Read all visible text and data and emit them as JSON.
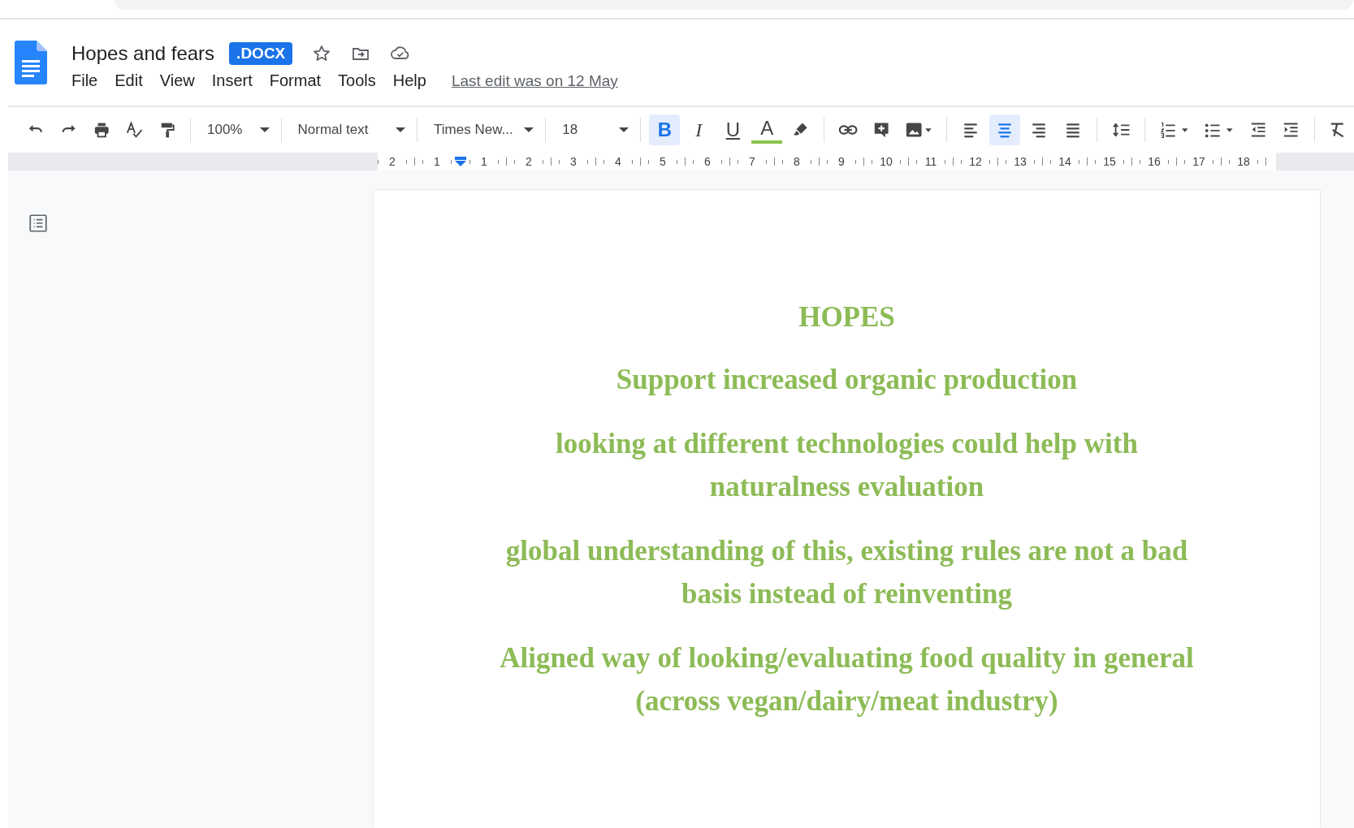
{
  "document": {
    "title": "Hopes and fears",
    "format_badge": ".DOCX",
    "last_edit": "Last edit was on 12 May"
  },
  "menu": [
    {
      "label": "File"
    },
    {
      "label": "Edit"
    },
    {
      "label": "View"
    },
    {
      "label": "Insert"
    },
    {
      "label": "Format"
    },
    {
      "label": "Tools"
    },
    {
      "label": "Help"
    }
  ],
  "toolbar": {
    "zoom": "100%",
    "style": "Normal text",
    "font": "Times New...",
    "size": "18",
    "format_buttons": [
      {
        "kind": "bold",
        "label": "B",
        "selected": true
      },
      {
        "kind": "italic",
        "label": "I",
        "selected": false
      },
      {
        "kind": "underline",
        "label": "U",
        "selected": false
      },
      {
        "kind": "color",
        "label": "A",
        "selected": false
      }
    ],
    "align_buttons": [
      {
        "kind": "left",
        "selected": false
      },
      {
        "kind": "center",
        "selected": true
      },
      {
        "kind": "right",
        "selected": false
      },
      {
        "kind": "justify",
        "selected": false
      }
    ]
  },
  "ruler": {
    "labels": [
      "2",
      "1",
      "1",
      "2",
      "3",
      "4",
      "5",
      "6",
      "7",
      "8",
      "9",
      "10",
      "11",
      "12",
      "13",
      "14",
      "15",
      "16",
      "17",
      "18"
    ]
  },
  "paragraphs": [
    {
      "kind": "heading",
      "text": "HOPES"
    },
    {
      "kind": "body",
      "text": "Support increased organic production"
    },
    {
      "kind": "body",
      "text": "looking at different technologies could help with naturalness evaluation"
    },
    {
      "kind": "body",
      "text": "global understanding of this, existing rules are not a bad basis instead of reinventing"
    },
    {
      "kind": "body",
      "text": "Aligned way of looking/evaluating food quality in general (across vegan/dairy/meat industry)"
    }
  ]
}
